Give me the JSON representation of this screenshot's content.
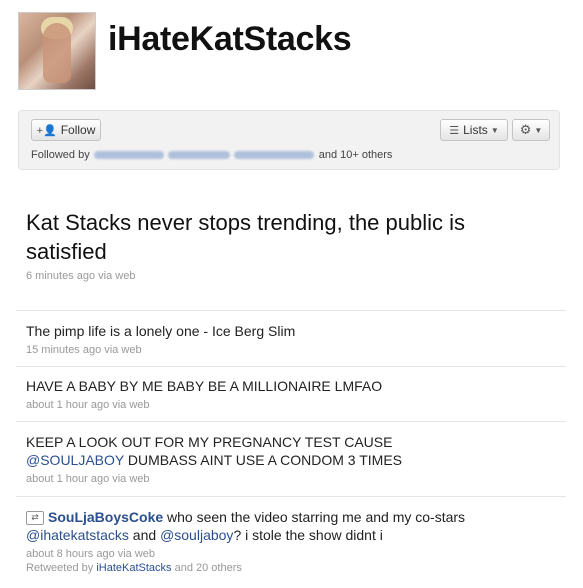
{
  "profile": {
    "screen_name": "iHateKatStacks",
    "follow_label": "Follow",
    "lists_label": "Lists",
    "followed_by_label": "Followed by",
    "followed_by_suffix": "and 10+ others"
  },
  "main_tweet": {
    "text": "Kat Stacks never stops trending, the public is satisfied",
    "meta": "6 minutes ago via web"
  },
  "tweets": [
    {
      "text": "The pimp life is a lonely one - Ice Berg Slim",
      "meta": "15 minutes ago via web"
    },
    {
      "text": "HAVE A BABY BY ME BABY BE A MILLIONAIRE LMFAO",
      "meta": "about 1 hour ago via web"
    },
    {
      "text_line1": "KEEP A LOOK OUT FOR MY PREGNANCY TEST CAUSE",
      "mention": "@SOULJABOY",
      "text_line2_rest": " DUMBASS AINT USE A CONDOM 3 TIMES",
      "meta": "about 1 hour ago via web"
    },
    {
      "author": "SouLjaBoysCoke",
      "text_part1": " who seen the video starring me and my co-stars ",
      "mention1": "@ihatekatstacks",
      "text_part2": " and ",
      "mention2": "@souljaboy",
      "text_part3": "? i stole the show didnt i",
      "meta": "about 8 hours ago via web",
      "retweeted_prefix": "Retweeted by ",
      "retweeted_by": "iHateKatStacks",
      "retweeted_suffix": " and 20 others"
    }
  ]
}
